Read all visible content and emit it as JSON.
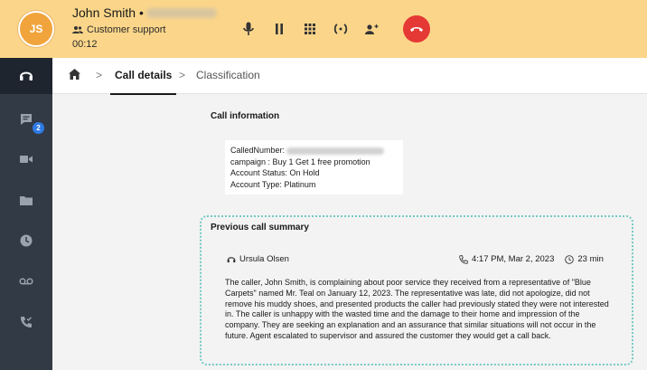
{
  "call": {
    "avatar_initials": "JS",
    "caller_name": "John Smith",
    "separator": "•",
    "queue": "Customer support",
    "timer": "00:12"
  },
  "breadcrumb": {
    "current": "Call details",
    "next": "Classification",
    "separator": ">"
  },
  "sidebar": {
    "chat_badge": "2"
  },
  "call_information": {
    "title": "Call information",
    "called_number_label": "CalledNumber:",
    "campaign": "campaign : Buy 1 Get 1 free promotion",
    "account_status": "Account Status: On Hold",
    "account_type": "Account Type: Platinum"
  },
  "previous_summary": {
    "title": "Previous call summary",
    "agent": "Ursula Olsen",
    "datetime": "4:17 PM, Mar 2, 2023",
    "duration": "23 min",
    "text": "The caller, John Smith, is complaining about poor service they received from a representative of \"Blue Carpets\" named Mr. Teal on January 12, 2023. The representative was late, did not apologize, did not remove his muddy shoes, and presented products the caller had previously stated they were not interested in. The caller is unhappy with the wasted time and the damage to their home and impression of the company. They are seeking an explanation and an assurance that similar situations will not occur in the future. Agent escalated to supervisor and assured the customer they would get a call back."
  },
  "icons": {
    "mute": "microphone-icon",
    "hold": "pause-icon",
    "keypad": "dialpad-icon",
    "transfer": "transfer-icon",
    "add_participant": "add-user-icon",
    "hangup": "hangup-icon"
  },
  "colors": {
    "topbar": "#fbd68a",
    "avatar": "#f1a43b",
    "sidebar": "#323a46",
    "hangup": "#e53935",
    "summary_border": "#74c9c4",
    "badge": "#2f7be5"
  }
}
